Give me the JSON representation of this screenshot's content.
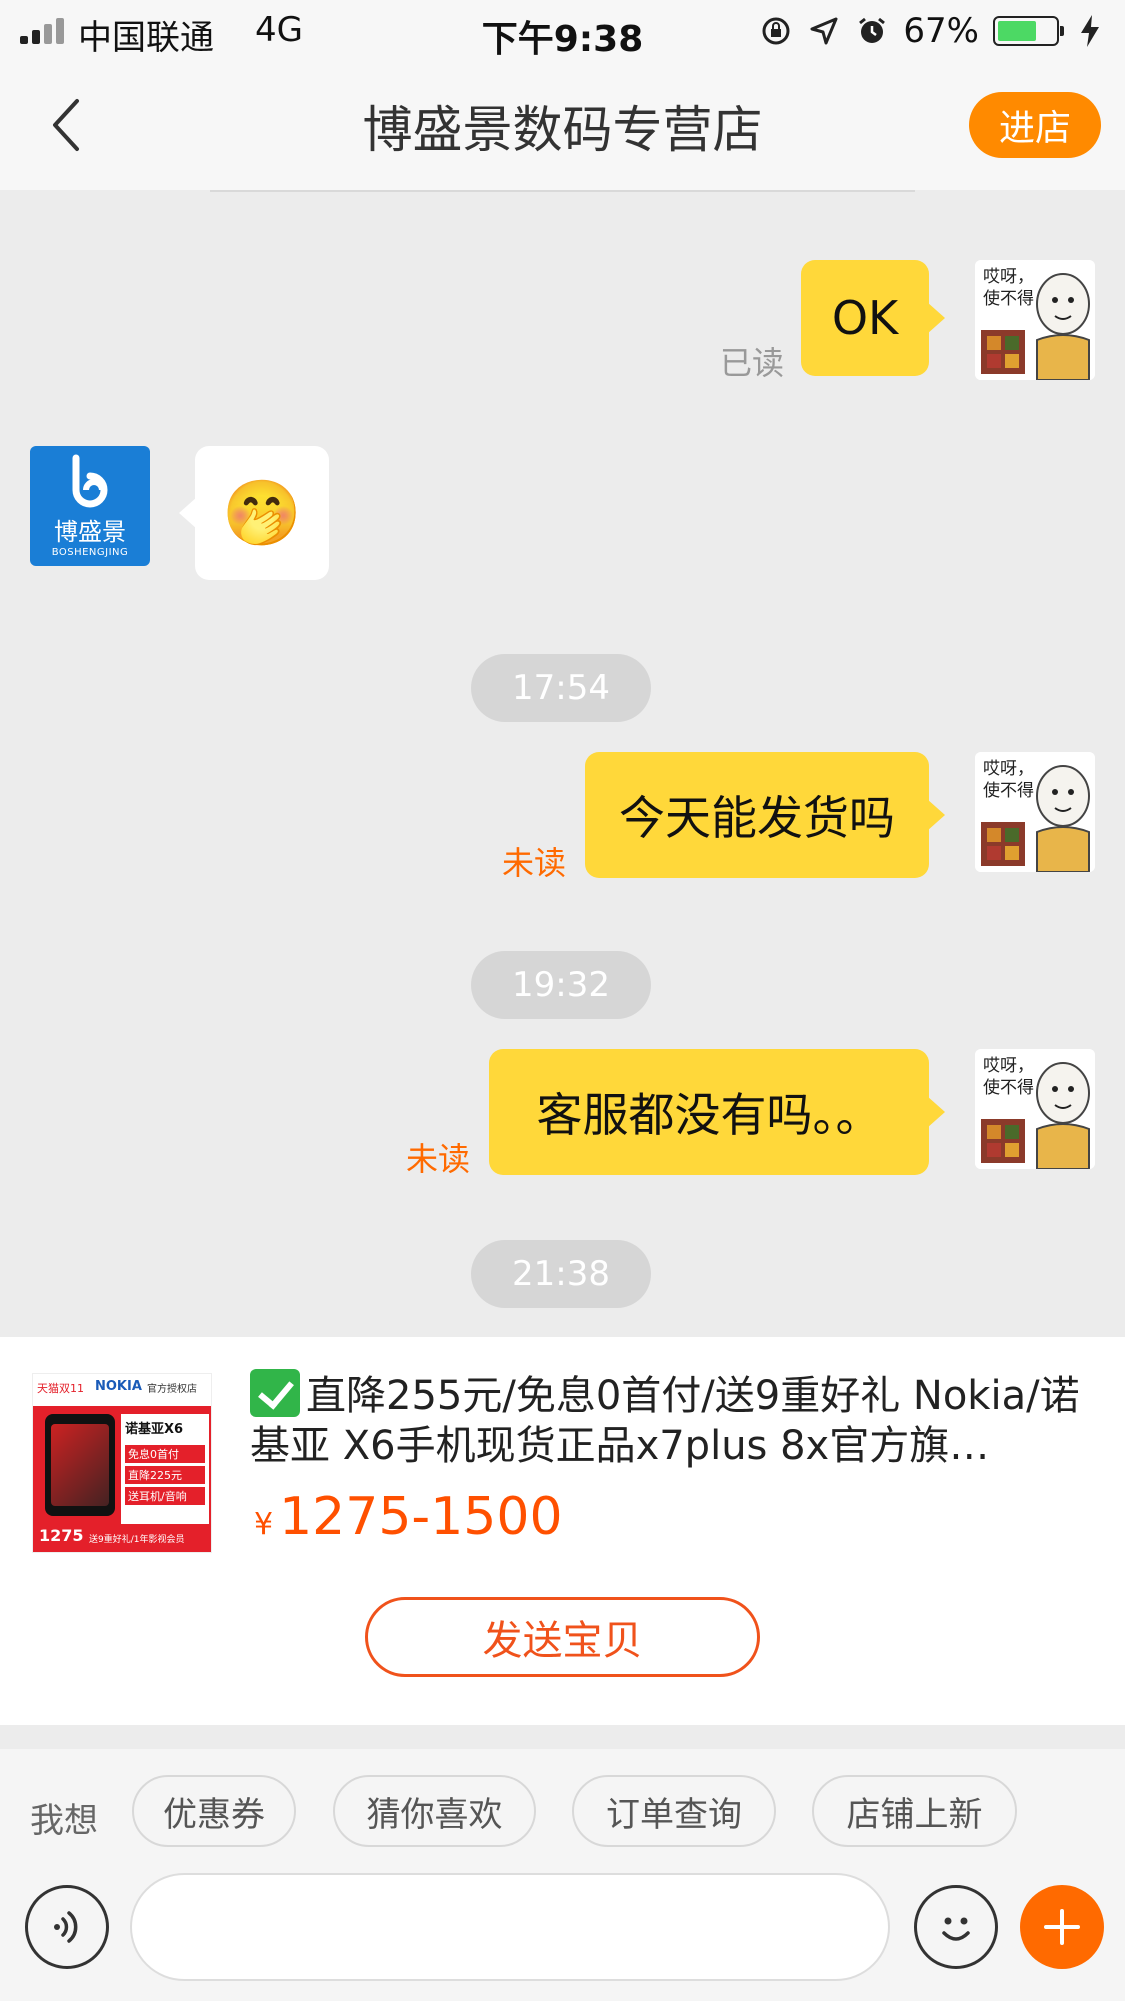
{
  "status_bar": {
    "carrier": "中国联通",
    "network": "4G",
    "time": "下午9:38",
    "battery_percent": "67%",
    "battery_level": 0.67,
    "icons": [
      "signal-icon",
      "rotation-lock-icon",
      "location-icon",
      "alarm-icon",
      "battery-icon",
      "charging-icon"
    ]
  },
  "nav": {
    "back_icon": "chevron-left-icon",
    "title": "博盛景数码专营店",
    "enter_shop": "进店"
  },
  "colors": {
    "accent": "#ff8a00",
    "bubble_out": "#ffd83a",
    "unread": "#ff6a00",
    "price": "#ff5000",
    "shop_brand": "#1a7ed6"
  },
  "shop": {
    "logo_text": "博盛景",
    "logo_subtext": "BOSHENGJING"
  },
  "self_avatar": {
    "text": "哎呀，使不得"
  },
  "messages": [
    {
      "type": "outgoing",
      "text": "OK",
      "status": "已读"
    },
    {
      "type": "incoming",
      "text": "🤭"
    },
    {
      "type": "time",
      "text": "17:54"
    },
    {
      "type": "outgoing",
      "text": "今天能发货吗",
      "status": "未读"
    },
    {
      "type": "time",
      "text": "19:32"
    },
    {
      "type": "outgoing",
      "text": "客服都没有吗。。",
      "status": "未读"
    },
    {
      "type": "time",
      "text": "21:38"
    }
  ],
  "product": {
    "title": "直降255元/免息0首付/送9重好礼 Nokia/诺基亚 X6手机现货正品x7plus 8x官方旗…",
    "price_symbol": "¥",
    "price": "1275-1500",
    "send_button": "发送宝贝",
    "thumb": {
      "brand": "NOKIA",
      "badge": "天猫双11",
      "store": "官方授权店",
      "model": "诺基亚X6",
      "features": [
        "免息0首付",
        "直降225元",
        "送耳机/音响"
      ],
      "price": "1275",
      "bottom": "送9重好礼/1年影视会员"
    }
  },
  "quick": {
    "label": "我想",
    "chips": [
      "优惠券",
      "猜你喜欢",
      "订单查询",
      "店铺上新"
    ]
  },
  "input": {
    "voice_icon": "voice-icon",
    "emoji_icon": "emoji-icon",
    "plus_icon": "plus-icon",
    "placeholder": ""
  }
}
